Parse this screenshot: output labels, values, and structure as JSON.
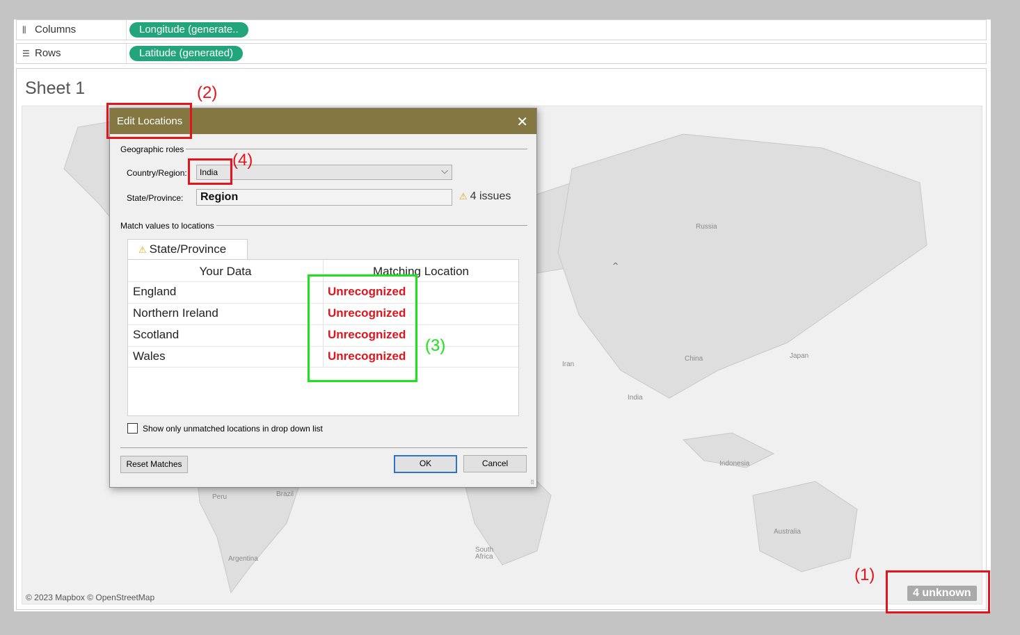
{
  "shelves": {
    "columns": {
      "label": "Columns",
      "pill": "Longitude (generate.."
    },
    "rows": {
      "label": "Rows",
      "pill": "Latitude (generated)"
    }
  },
  "sheet": {
    "title": "Sheet 1",
    "map_labels": [
      "Russia",
      "China",
      "India",
      "Iran",
      "Japan",
      "Indonesia",
      "Australia",
      "Brazil",
      "Peru",
      "Argentina",
      "South Africa"
    ],
    "attribution": "© 2023 Mapbox © OpenStreetMap",
    "unknown_badge": "4 unknown"
  },
  "dialog": {
    "title": "Edit Locations",
    "geographic_roles_label": "Geographic roles",
    "country_label": "Country/Region:",
    "country_value": "India",
    "state_label": "State/Province:",
    "state_value": "Region",
    "issues": "4 issues",
    "match_label": "Match values to locations",
    "tab_label": "State/Province",
    "headers": {
      "your_data": "Your Data",
      "matching_location": "Matching Location"
    },
    "rows": [
      {
        "data": "England",
        "match": "Unrecognized"
      },
      {
        "data": "Northern Ireland",
        "match": "Unrecognized"
      },
      {
        "data": "Scotland",
        "match": "Unrecognized"
      },
      {
        "data": "Wales",
        "match": "Unrecognized"
      }
    ],
    "checkbox_label": "Show only unmatched locations in drop down list",
    "checkbox_checked": false,
    "buttons": {
      "reset": "Reset Matches",
      "ok": "OK",
      "cancel": "Cancel"
    }
  },
  "annotations": {
    "a1": "(1)",
    "a2": "(2)",
    "a3": "(3)",
    "a4": "(4)"
  },
  "colors": {
    "title_bar": "#857741",
    "pill": "#23a57b",
    "unrecognized": "#e0141a",
    "annotation_red": "#e3141b",
    "annotation_green": "#1be21b"
  },
  "icons": {
    "columns": "columns-icon",
    "rows": "rows-icon",
    "close": "close-icon",
    "warning": "warning-icon",
    "dropdown": "chevron-down-icon"
  }
}
